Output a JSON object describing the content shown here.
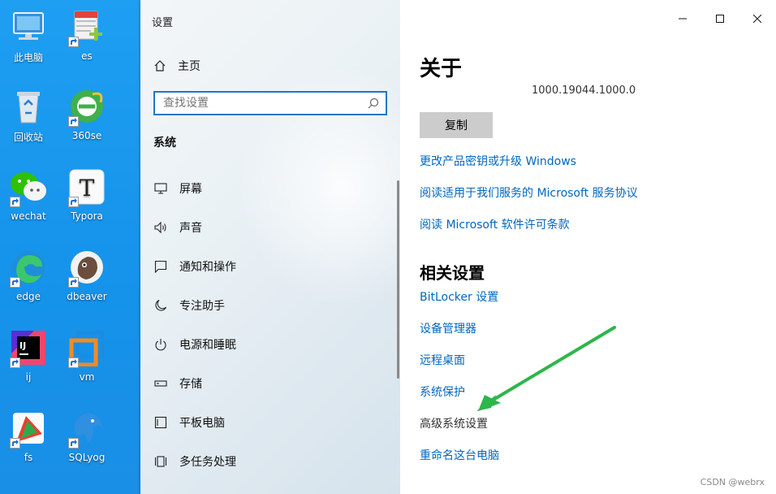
{
  "desktop": {
    "icons": [
      {
        "label": "此电脑",
        "name": "this-pc-icon"
      },
      {
        "label": "es",
        "name": "es-icon"
      },
      {
        "label": "回收站",
        "name": "recycle-bin-icon"
      },
      {
        "label": "360se",
        "name": "360se-icon"
      },
      {
        "label": "wechat",
        "name": "wechat-icon"
      },
      {
        "label": "Typora",
        "name": "typora-icon"
      },
      {
        "label": "edge",
        "name": "edge-icon"
      },
      {
        "label": "dbeaver",
        "name": "dbeaver-icon"
      },
      {
        "label": "ij",
        "name": "intellij-icon"
      },
      {
        "label": "vm",
        "name": "vmware-icon"
      },
      {
        "label": "fs",
        "name": "fs-icon"
      },
      {
        "label": "SQLyog",
        "name": "sqlyog-icon"
      }
    ]
  },
  "window": {
    "title": "设置",
    "controls": {
      "minimize": "minimize",
      "maximize": "maximize",
      "close": "close"
    }
  },
  "nav": {
    "home_label": "主页",
    "search_placeholder": "查找设置",
    "section_label": "系统",
    "items": [
      {
        "label": "屏幕",
        "icon": "monitor-icon"
      },
      {
        "label": "声音",
        "icon": "speaker-icon"
      },
      {
        "label": "通知和操作",
        "icon": "notification-icon"
      },
      {
        "label": "专注助手",
        "icon": "moon-icon"
      },
      {
        "label": "电源和睡眠",
        "icon": "power-icon"
      },
      {
        "label": "存储",
        "icon": "storage-icon"
      },
      {
        "label": "平板电脑",
        "icon": "tablet-icon"
      },
      {
        "label": "多任务处理",
        "icon": "multitask-icon"
      }
    ]
  },
  "content": {
    "title": "关于",
    "version": "1000.19044.1000.0",
    "copy_button": "复制",
    "links": [
      "更改产品密钥或升级 Windows",
      "阅读适用于我们服务的 Microsoft 服务协议",
      "阅读 Microsoft 软件许可条款"
    ],
    "related_heading": "相关设置",
    "related_links": [
      "BitLocker 设置",
      "设备管理器",
      "远程桌面",
      "系统保护",
      "高级系统设置",
      "重命名这台电脑"
    ]
  },
  "annotation": {
    "arrow_color": "#2db64a",
    "points_to": "高级系统设置"
  },
  "watermark": "CSDN @webrx",
  "colors": {
    "desktop": "#1592ea",
    "link": "#0067c0",
    "search_border": "#1e78c6"
  }
}
